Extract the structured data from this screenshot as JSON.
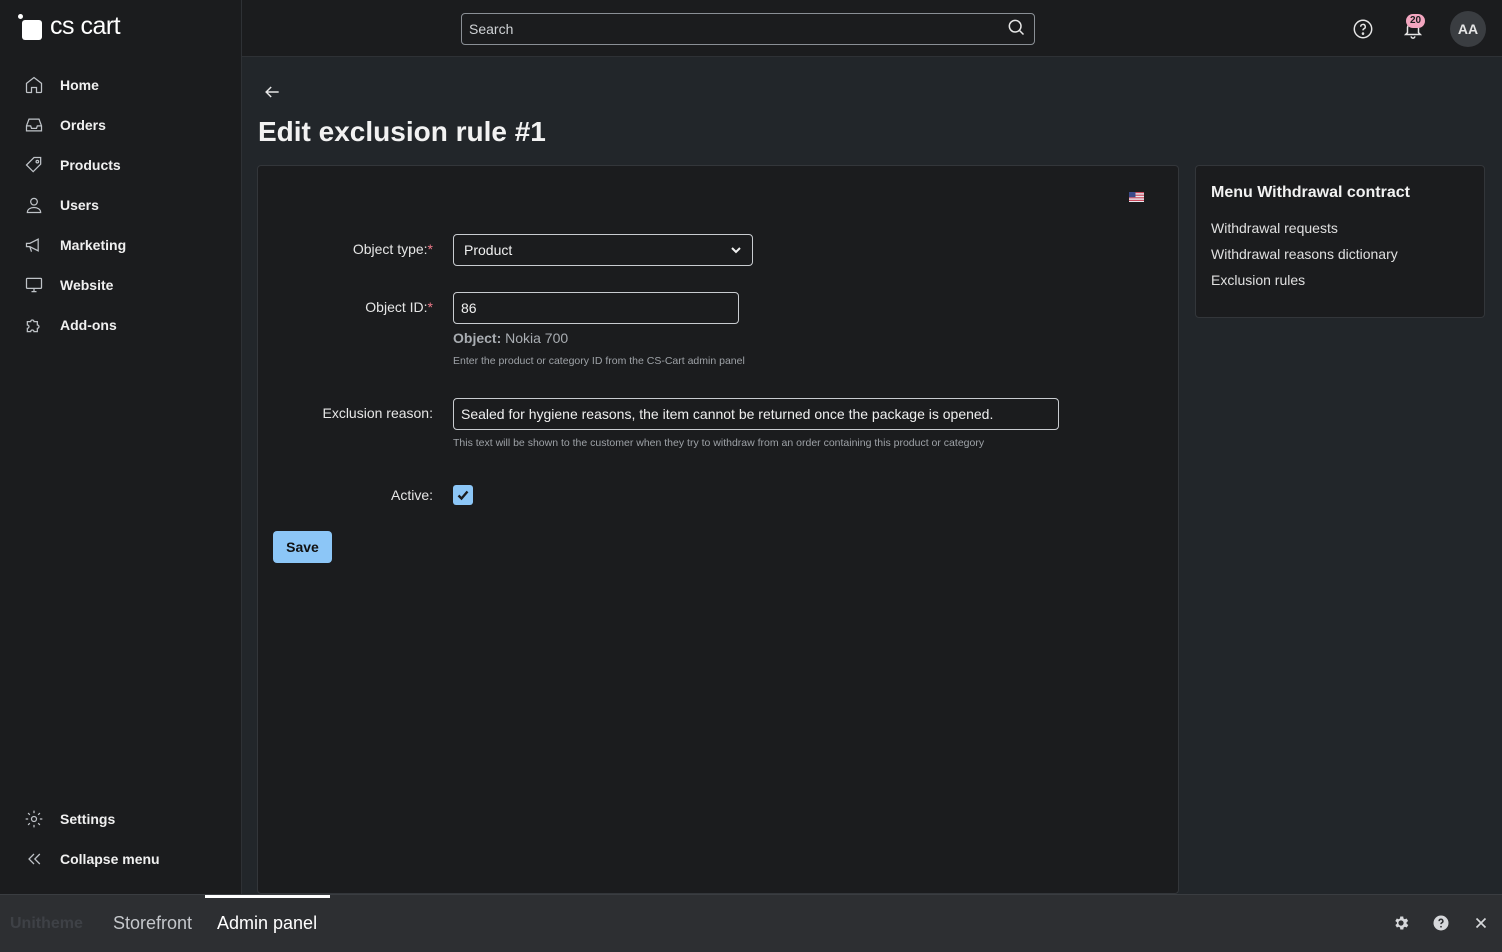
{
  "app": {
    "logo_text": "cs cart"
  },
  "sidebar": {
    "items": [
      {
        "label": "Home",
        "icon": "home-icon"
      },
      {
        "label": "Orders",
        "icon": "inbox-icon"
      },
      {
        "label": "Products",
        "icon": "tag-icon"
      },
      {
        "label": "Users",
        "icon": "user-icon"
      },
      {
        "label": "Marketing",
        "icon": "megaphone-icon"
      },
      {
        "label": "Website",
        "icon": "monitor-icon"
      },
      {
        "label": "Add-ons",
        "icon": "puzzle-icon"
      }
    ],
    "bottom_items": [
      {
        "label": "Settings",
        "icon": "gear-icon"
      },
      {
        "label": "Collapse menu",
        "icon": "double-chevron-left-icon"
      }
    ]
  },
  "topbar": {
    "search_placeholder": "Search",
    "notifications_count": "20",
    "avatar_initials": "AA"
  },
  "page": {
    "title": "Edit exclusion rule #1"
  },
  "form": {
    "object_type_label": "Object type:",
    "object_type_value": "Product",
    "object_id_label": "Object ID:",
    "object_id_value": "86",
    "object_prefix": "Object:",
    "object_name": "Nokia 700",
    "object_id_hint": "Enter the product or category ID from the CS-Cart admin panel",
    "reason_label": "Exclusion reason:",
    "reason_value": "Sealed for hygiene reasons, the item cannot be returned once the package is opened.",
    "reason_hint": "This text will be shown to the customer when they try to withdraw from an order containing this product or category",
    "active_label": "Active:",
    "active_checked": true,
    "required_mark": "*",
    "save_label": "Save"
  },
  "side_menu": {
    "title": "Menu Withdrawal contract",
    "links": [
      "Withdrawal requests",
      "Withdrawal reasons dictionary",
      "Exclusion rules"
    ]
  },
  "bottombar": {
    "brand": "Unitheme",
    "tabs": [
      "Storefront",
      "Admin panel"
    ],
    "active_tab": "Admin panel"
  },
  "colors": {
    "accent": "#8cc6f7",
    "badge": "#f3a6c0",
    "required": "#f07a8a",
    "background": "#22262a",
    "panel": "#1b1c1e"
  }
}
